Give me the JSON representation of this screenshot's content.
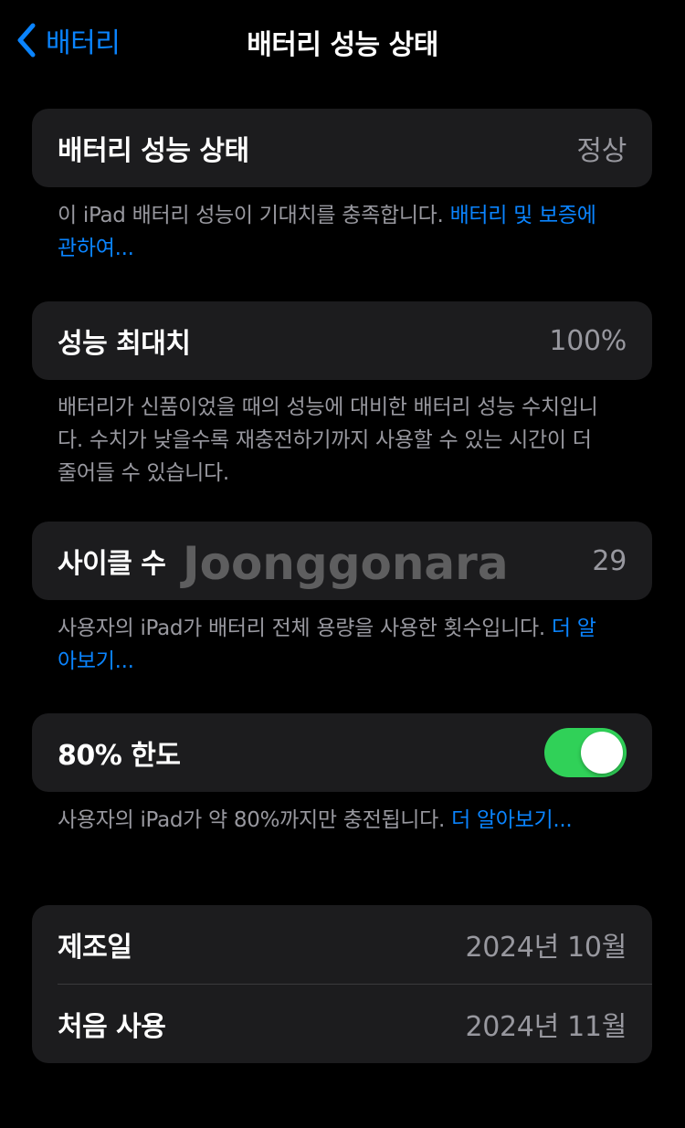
{
  "nav": {
    "back_label": "배터리",
    "title": "배터리 성능 상태"
  },
  "health": {
    "label": "배터리 성능 상태",
    "value": "정상",
    "footnote_text": "이 iPad 배터리 성능이 기대치를 충족합니다. ",
    "footnote_link": "배터리 및 보증에 관하여..."
  },
  "max_capacity": {
    "label": "성능 최대치",
    "value": "100%",
    "footnote_text": "배터리가 신품이었을 때의 성능에 대비한 배터리 성능 수치입니다. 수치가 낮을수록 재충전하기까지 사용할 수 있는 시간이 더 줄어들 수 있습니다."
  },
  "cycle_count": {
    "label": "사이클 수",
    "value": "29",
    "footnote_text": "사용자의 iPad가 배터리 전체 용량을 사용한 횟수입니다. ",
    "footnote_link": "더 알아보기..."
  },
  "limit_80": {
    "label": "80% 한도",
    "toggle_on": true,
    "toggle_color": "#30d158",
    "footnote_text": "사용자의 iPad가 약 80%까지만 충전됩니다. ",
    "footnote_link": "더 알아보기..."
  },
  "dates": {
    "manufacture_label": "제조일",
    "manufacture_value": "2024년 10월",
    "first_use_label": "처음 사용",
    "first_use_value": "2024년 11월"
  },
  "watermark": "Joonggonara",
  "colors": {
    "accent": "#0a84ff",
    "background": "#000000",
    "card": "#1c1c1e"
  }
}
